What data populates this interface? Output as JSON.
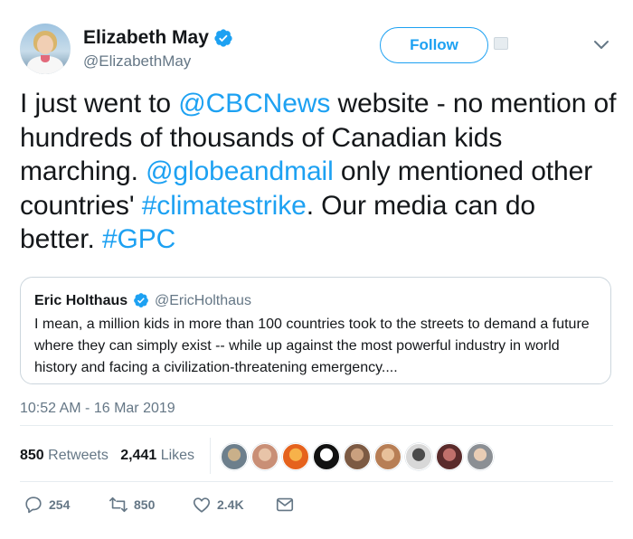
{
  "author": {
    "name": "Elizabeth May",
    "handle": "@ElizabethMay",
    "verified": true
  },
  "follow_label": "Follow",
  "tweet": {
    "segments": [
      {
        "text": "I just went to ",
        "link": false
      },
      {
        "text": "@CBCNews",
        "link": true
      },
      {
        "text": " website - no mention of hundreds of thousands of Canadian kids marching. ",
        "link": false
      },
      {
        "text": "@globeandmail",
        "link": true
      },
      {
        "text": " only mentioned other countries' ",
        "link": false
      },
      {
        "text": "#climatestrike",
        "link": true
      },
      {
        "text": ". Our media can do better. ",
        "link": false
      },
      {
        "text": "#GPC",
        "link": true
      }
    ]
  },
  "quote": {
    "name": "Eric Holthaus",
    "handle": "@EricHolthaus",
    "verified": true,
    "text": "I mean, a million kids in more than 100 countries took to the streets to demand a future where they can simply exist -- while up against the most powerful industry in world history and facing a civilization-threatening emergency...."
  },
  "timestamp": "10:52 AM - 16 Mar 2019",
  "stats": {
    "retweets_count": "850",
    "retweets_label": "Retweets",
    "likes_count": "2,441",
    "likes_label": "Likes"
  },
  "liker_avatars": [
    {
      "color": "#6d7f8c",
      "accent": "#c9b08a"
    },
    {
      "color": "#c98f76",
      "accent": "#e8c4a8"
    },
    {
      "color": "#e5621d",
      "accent": "#f7b24a"
    },
    {
      "color": "#111111",
      "accent": "#ffffff"
    },
    {
      "color": "#7c5a43",
      "accent": "#caa07e"
    },
    {
      "color": "#b77e55",
      "accent": "#e7c09a"
    },
    {
      "color": "#d8d8d8",
      "accent": "#4b4b4b"
    },
    {
      "color": "#5a2b2b",
      "accent": "#c0706b"
    },
    {
      "color": "#8b8f94",
      "accent": "#e9cdb5"
    }
  ],
  "actions": {
    "replies": "254",
    "retweets": "850",
    "likes": "2.4K"
  },
  "colors": {
    "link": "#1da1f2",
    "text": "#14171a",
    "secondary": "#657786",
    "border": "#ccd6dd"
  }
}
